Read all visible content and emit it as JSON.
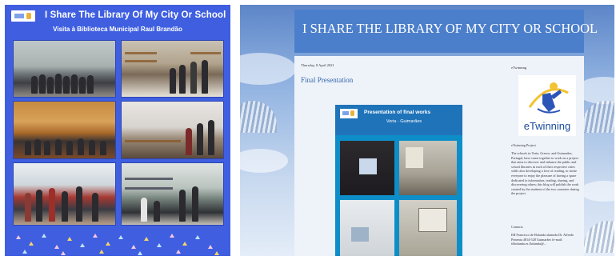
{
  "poster": {
    "title": "I Share The Library Of My City Or School",
    "subtitle": "Visita à Biblioteca Municipal Raul Brandão",
    "colors": {
      "background": "#3f5fe0",
      "text": "#ffffff"
    },
    "photos": [
      "group-at-library-entrance",
      "students-in-reading-room",
      "students-seated-on-steps",
      "students-at-computers",
      "students-browsing-shelves",
      "students-at-bookshelves"
    ]
  },
  "blog": {
    "title": "I SHARE THE LIBRARY OF MY CITY OR SCHOOL",
    "post": {
      "date": "Thursday, 8 April 2021",
      "title": "Final Presentation",
      "slide": {
        "title": "Presentation of final works",
        "subtitle": "Veria - Guimarães"
      }
    },
    "sidebar": {
      "heading": "eTwinning",
      "logo_text": "eTwinning",
      "project_heading": "eTwinning Project",
      "project_text": "The schools in Veria, Greece, and Guimarães, Portugal, have come together to work on a project that aims to discover and enhance the public and school libraries in each of their respective cities while also developing a love of reading, to invite everyone to enjoy the pleasure of having a space dedicated to information, reading, sharing, and discovering others; this blog will publish the work created by the students of the two countries during the project.",
      "contacts_heading": "Contacts",
      "contacts_text": "EB Francisco de Holanda alameda Dr. Alfredo Pimenta 4814-528 Guimarães fe-mail: fdholanda.es.fholanda@..."
    },
    "colors": {
      "header": "#4c7fcb",
      "accent": "#3466a8",
      "body": "#eef3fa"
    }
  }
}
